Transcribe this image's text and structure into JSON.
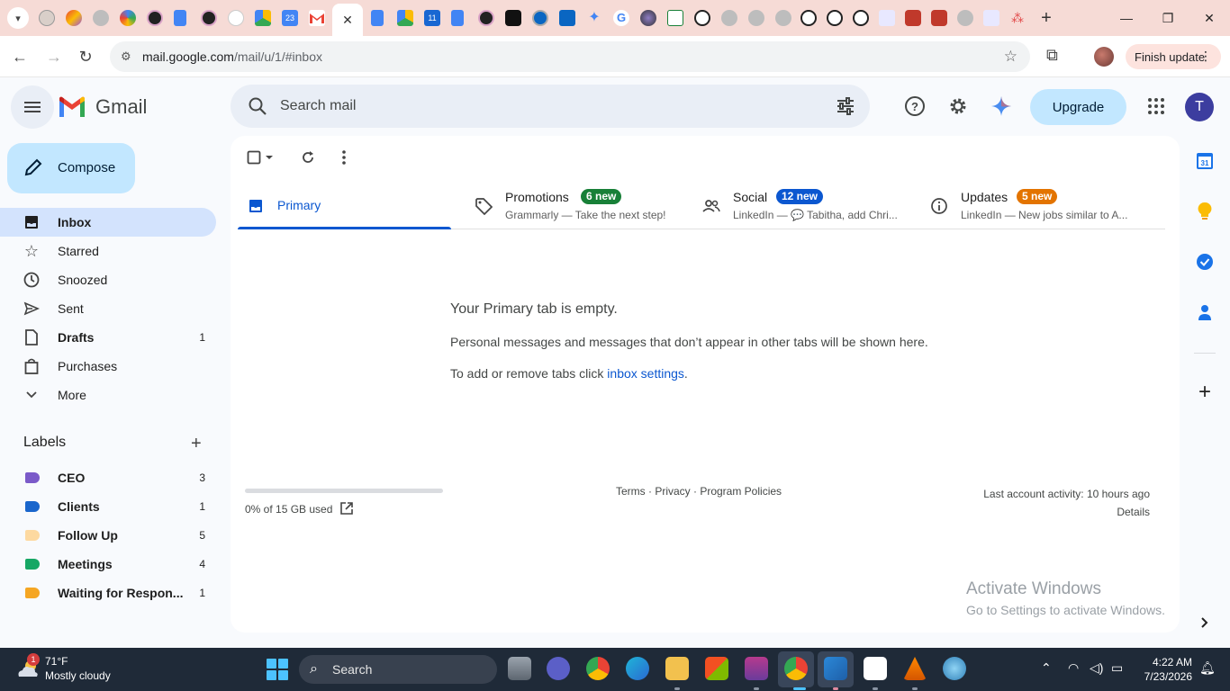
{
  "browser": {
    "url_host": "mail.google.com",
    "url_path": "/mail/u/1/#inbox",
    "finish_update_label": "Finish update",
    "gemini_tab_number": "23",
    "calendar_tab_number": "11"
  },
  "gmail": {
    "product_name": "Gmail",
    "search_placeholder": "Search mail",
    "upgrade_label": "Upgrade",
    "avatar_initial": "T",
    "compose_label": "Compose"
  },
  "sidebar": {
    "items": [
      {
        "label": "Inbox",
        "count": ""
      },
      {
        "label": "Starred",
        "count": ""
      },
      {
        "label": "Snoozed",
        "count": ""
      },
      {
        "label": "Sent",
        "count": ""
      },
      {
        "label": "Drafts",
        "count": "1"
      },
      {
        "label": "Purchases",
        "count": ""
      },
      {
        "label": "More",
        "count": ""
      }
    ],
    "labels_title": "Labels",
    "labels": [
      {
        "name": "CEO",
        "count": "3",
        "color": "#7b5ac9"
      },
      {
        "name": "Clients",
        "count": "1",
        "color": "#1a66cc"
      },
      {
        "name": "Follow Up",
        "count": "5",
        "color": "#fdd9a0"
      },
      {
        "name": "Meetings",
        "count": "4",
        "color": "#16a765"
      },
      {
        "name": "Waiting for Respon...",
        "count": "1",
        "color": "#f5a623"
      }
    ]
  },
  "tabs": [
    {
      "name": "Primary",
      "badge": "",
      "subtitle": ""
    },
    {
      "name": "Promotions",
      "badge": "6 new",
      "subtitle": "Grammarly — Take the next step!",
      "badge_color": "#188038"
    },
    {
      "name": "Social",
      "badge": "12 new",
      "subtitle": "LinkedIn — 💬 Tabitha, add Chri...",
      "badge_color": "#0b57d0"
    },
    {
      "name": "Updates",
      "badge": "5 new",
      "subtitle": "LinkedIn — New jobs similar to A...",
      "badge_color": "#e37400"
    }
  ],
  "empty_state": {
    "title": "Your Primary tab is empty.",
    "description": "Personal messages and messages that don’t appear in other tabs will be shown here.",
    "add_prefix": "To add or remove tabs click ",
    "add_link": "inbox settings",
    "add_suffix": "."
  },
  "footer": {
    "storage": "0% of 15 GB used",
    "links": "Terms · Privacy · Program Policies",
    "activity": "Last account activity: 10 hours ago",
    "details": "Details"
  },
  "windows_watermark": {
    "line1": "Activate Windows",
    "line2": "Go to Settings to activate Windows."
  },
  "side_panel": {
    "calendar_day": "31"
  },
  "taskbar": {
    "weather_temp": "71°F",
    "weather_cond": "Mostly cloudy",
    "weather_badge": "1",
    "search_label": "Search",
    "time": "4:22 AM",
    "date": "7/23/2026"
  },
  "colors": {
    "accent": "#0b57d0",
    "compose_bg": "#c2e7ff",
    "active_nav_bg": "#d3e3fd"
  }
}
